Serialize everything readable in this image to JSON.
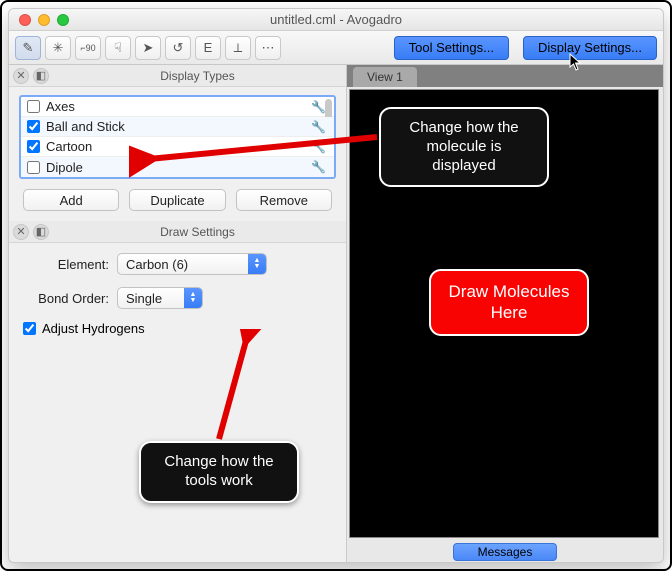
{
  "window": {
    "title": "untitled.cml - Avogadro"
  },
  "toolbar": {
    "icons": [
      "✎",
      "✳",
      "⌐90",
      "☟",
      "➤",
      "↺",
      "E",
      "⟂",
      "⋯"
    ],
    "tool_settings": "Tool Settings...",
    "display_settings": "Display Settings..."
  },
  "display_types": {
    "header": "Display Types",
    "items": [
      {
        "label": "Axes",
        "checked": false
      },
      {
        "label": "Ball and Stick",
        "checked": true
      },
      {
        "label": "Cartoon",
        "checked": true
      },
      {
        "label": "Dipole",
        "checked": false
      }
    ],
    "add": "Add",
    "duplicate": "Duplicate",
    "remove": "Remove"
  },
  "draw_settings": {
    "header": "Draw Settings",
    "element_label": "Element:",
    "element_value": "Carbon (6)",
    "bond_label": "Bond Order:",
    "bond_value": "Single",
    "adjust_h": "Adjust Hydrogens"
  },
  "view": {
    "tab": "View 1",
    "messages": "Messages"
  },
  "callouts": {
    "display": "Change how the molecule is displayed",
    "draw": "Draw Molecules Here",
    "tools": "Change how the tools work"
  }
}
